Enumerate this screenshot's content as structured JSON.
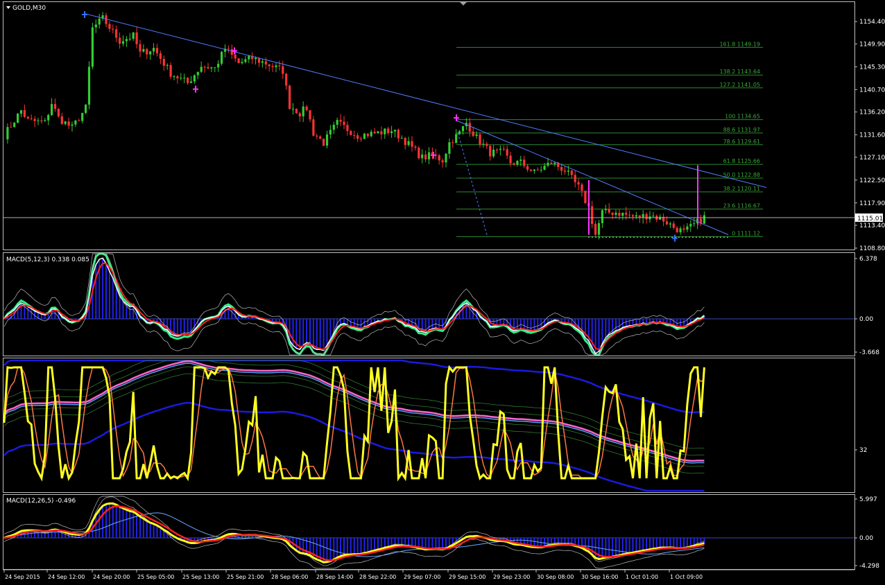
{
  "window": {
    "symbol_label": "GOLD,M30"
  },
  "price_panel": {
    "axis_labels": [
      "1154.40",
      "1149.90",
      "1145.30",
      "1140.70",
      "1136.20",
      "1131.60",
      "1127.10",
      "1122.50",
      "1117.90",
      "1113.40",
      "1108.80"
    ],
    "current_price": "1115.01",
    "fib_levels": [
      "161.8 1149.19",
      "138.2 1143.64",
      "127.2 1141.05",
      "100 1134.65",
      "88.6 1131.97",
      "78.6 1129.61",
      "61.8 1125.66",
      "50.0 1122.88",
      "38.2 1120.11",
      "23.6 1116.67",
      "0 1111.12"
    ]
  },
  "macd1_panel": {
    "title": "MACD(5,12,3) 0.338 0.085",
    "axis_labels": [
      "6.378",
      "0.00",
      "-3.668"
    ]
  },
  "oscillator_panel": {
    "axis_labels": [
      "32"
    ]
  },
  "macd2_panel": {
    "title": "MACD(12,26,5) -0.496",
    "axis_labels": [
      "5.997",
      "0.00",
      "-4.298"
    ]
  },
  "time_axis": {
    "labels": [
      "24 Sep 2015",
      "24 Sep 12:00",
      "24 Sep 20:00",
      "25 Sep 05:00",
      "25 Sep 13:00",
      "25 Sep 21:00",
      "28 Sep 06:00",
      "28 Sep 14:00",
      "28 Sep 22:00",
      "29 Sep 07:00",
      "29 Sep 15:00",
      "29 Sep 23:00",
      "30 Sep 08:00",
      "30 Sep 16:00",
      "1 Oct 01:00",
      "1 Oct 09:00"
    ]
  },
  "colors": {
    "background": "#000000",
    "frame": "#c0c0c0",
    "bull_candle": "#33cc33",
    "bear_candle": "#ff3333",
    "trendline": "#4f7fff",
    "fib": "#2e8b2e",
    "fib_text": "#3aa83a",
    "magenta": "#ff33ff",
    "macd_hist": "#2222ee",
    "signal_red": "#ff2020",
    "line_green": "#33ee88",
    "yellow": "#ffff22",
    "orange": "#ff7744"
  },
  "chart_data": {
    "type": "candlestick",
    "symbol": "GOLD",
    "ylim": [
      1108.8,
      1156.5
    ],
    "anchors": [
      [
        0,
        1131.5
      ],
      [
        5,
        1136.5
      ],
      [
        7,
        1134.5
      ],
      [
        12,
        1134
      ],
      [
        14,
        1138
      ],
      [
        16,
        1135
      ],
      [
        20,
        1133
      ],
      [
        24,
        1137
      ],
      [
        26,
        1153
      ],
      [
        29,
        1155
      ],
      [
        34,
        1150.5
      ],
      [
        38,
        1151.5
      ],
      [
        40,
        1148
      ],
      [
        44,
        1149
      ],
      [
        47,
        1146
      ],
      [
        49,
        1144
      ],
      [
        54,
        1142
      ],
      [
        58,
        1145.5
      ],
      [
        62,
        1145
      ],
      [
        65,
        1149
      ],
      [
        69,
        1146
      ],
      [
        73,
        1147
      ],
      [
        77,
        1146
      ],
      [
        82,
        1144.5
      ],
      [
        84,
        1137.5
      ],
      [
        87,
        1136
      ],
      [
        89,
        1137
      ],
      [
        91,
        1132
      ],
      [
        94,
        1130
      ],
      [
        98,
        1134
      ],
      [
        104,
        1131.5
      ],
      [
        110,
        1132
      ],
      [
        114,
        1132.5
      ],
      [
        117,
        1131
      ],
      [
        120,
        1129
      ],
      [
        123,
        1127
      ],
      [
        126,
        1127.5
      ],
      [
        129,
        1126.5
      ],
      [
        131,
        1130
      ],
      [
        134,
        1132
      ],
      [
        136,
        1134
      ],
      [
        139,
        1131
      ],
      [
        143,
        1128
      ],
      [
        147,
        1128
      ],
      [
        149,
        1126
      ],
      [
        152,
        1126
      ],
      [
        156,
        1124
      ],
      [
        161,
        1126
      ],
      [
        165,
        1124.5
      ],
      [
        169,
        1121
      ],
      [
        172,
        1117
      ],
      [
        174,
        1111.5
      ],
      [
        176,
        1116
      ],
      [
        180,
        1116
      ],
      [
        186,
        1115
      ],
      [
        190,
        1115.5
      ],
      [
        194,
        1114.5
      ],
      [
        197,
        1113
      ],
      [
        200,
        1112
      ],
      [
        203,
        1113.5
      ],
      [
        206,
        1115
      ]
    ]
  }
}
